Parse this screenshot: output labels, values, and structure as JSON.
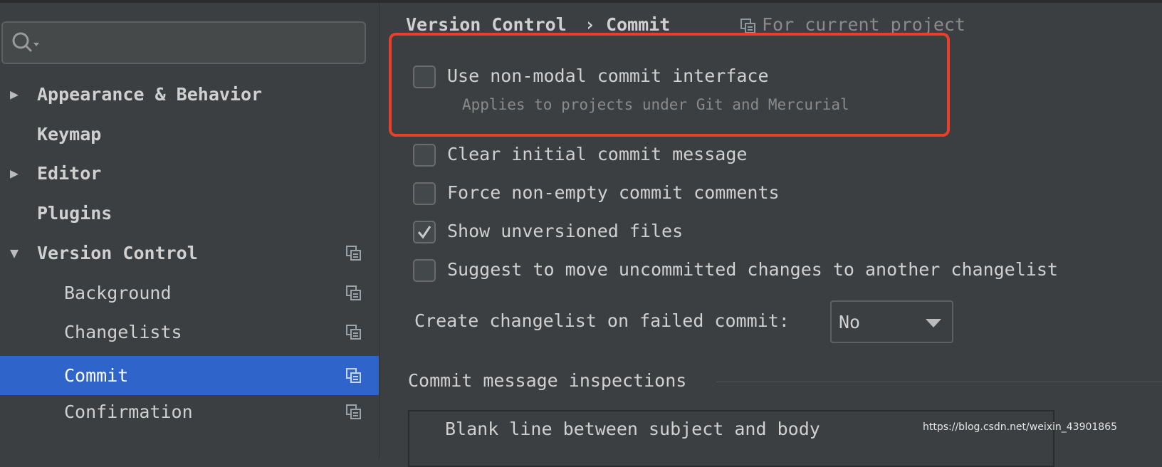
{
  "sidebar": {
    "search_placeholder": "",
    "items": [
      {
        "label": "Appearance & Behavior",
        "expandable": true,
        "expanded": false
      },
      {
        "label": "Keymap"
      },
      {
        "label": "Editor",
        "expandable": true,
        "expanded": false
      },
      {
        "label": "Plugins"
      },
      {
        "label": "Version Control",
        "expandable": true,
        "expanded": true,
        "project_icon": true
      },
      {
        "label": "Background",
        "project_icon": true
      },
      {
        "label": "Changelists",
        "project_icon": true
      },
      {
        "label": "Commit",
        "project_icon": true,
        "selected": true
      },
      {
        "label": "Confirmation",
        "project_icon": true
      }
    ]
  },
  "main": {
    "breadcrumb": {
      "parent": "Version Control",
      "separator": "›",
      "current": "Commit"
    },
    "scope_label": "For current project",
    "options": [
      {
        "label": "Use non-modal commit interface",
        "checked": false,
        "hint": "Applies to projects under Git and Mercurial"
      },
      {
        "label": "Clear initial commit message",
        "checked": false
      },
      {
        "label": "Force non-empty commit comments",
        "checked": false
      },
      {
        "label": "Show unversioned files",
        "checked": true
      },
      {
        "label": "Suggest to move uncommitted changes to another changelist",
        "checked": false
      }
    ],
    "changelist_label": "Create changelist on failed commit:",
    "changelist_value": "No",
    "inspections_title": "Commit message inspections",
    "inspection_rows": [
      {
        "label": "Blank line between subject and body"
      }
    ]
  },
  "watermark": "https://blog.csdn.net/weixin_43901865",
  "colors": {
    "selection": "#2f65ca",
    "highlight_box": "#e8402b",
    "background": "#3c3f41"
  }
}
